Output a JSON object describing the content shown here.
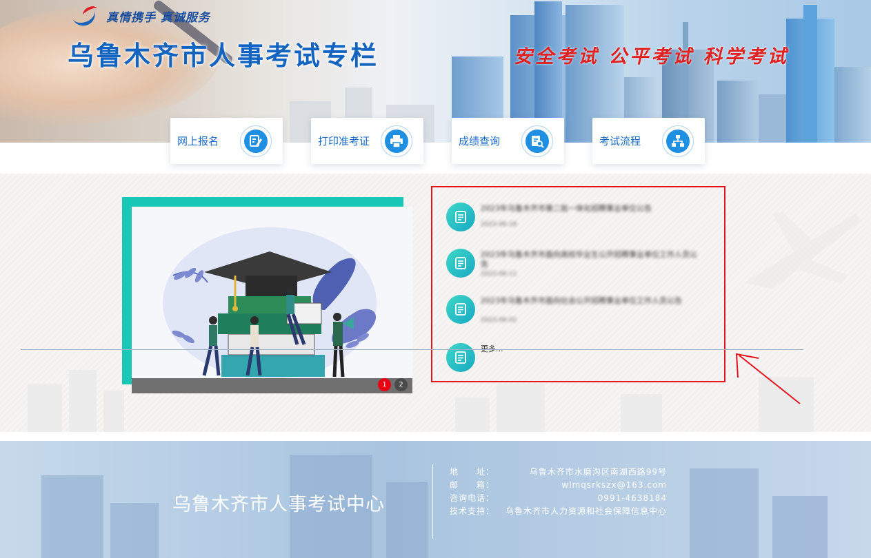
{
  "header": {
    "slogan_top": "真情携手 真诚服务",
    "site_title": "乌鲁木齐市人事考试专栏",
    "red_slogan": "安全考试 公平考试 科学考试"
  },
  "nav": [
    {
      "label": "网上报名",
      "icon": "edit-form-icon"
    },
    {
      "label": "打印准考证",
      "icon": "printer-icon"
    },
    {
      "label": "成绩查询",
      "icon": "search-document-icon"
    },
    {
      "label": "考试流程",
      "icon": "flowchart-icon"
    }
  ],
  "carousel": {
    "illustration": "graduation-cap-books-students-illustration",
    "dots": [
      "1",
      "2"
    ],
    "active_dot": "1",
    "active_color": "#e60012",
    "inactive_color": "#4a4a4a"
  },
  "news": {
    "items": [
      {
        "title": "2023年乌鲁木齐市第二批一体化招聘事业单位公告",
        "date": "2023-06-18"
      },
      {
        "title": "2023年乌鲁木齐市面向高校毕业生公开招聘事业单位工作人员公告",
        "date": "2023-06-11"
      },
      {
        "title": "2023年乌鲁木齐市面向社会公开招聘事业单位工作人员公告",
        "date": "2023-06-02"
      }
    ],
    "more_label": "更多..."
  },
  "footer": {
    "title": "乌鲁木齐市人事考试中心",
    "info": [
      {
        "key": "地　　址：",
        "value": "乌鲁木齐市水磨沟区南湖西路99号"
      },
      {
        "key": "邮　　箱：",
        "value": "wlmqsrkszx@163.com"
      },
      {
        "key": "咨询电话：",
        "value": "0991-4638184"
      },
      {
        "key": "技术支持：",
        "value": "乌鲁木齐市人力资源和社会保障信息中心"
      }
    ]
  },
  "colors": {
    "brand_blue": "#1264c0",
    "accent_teal": "#19c7b6",
    "highlight_red": "#e3141b"
  }
}
